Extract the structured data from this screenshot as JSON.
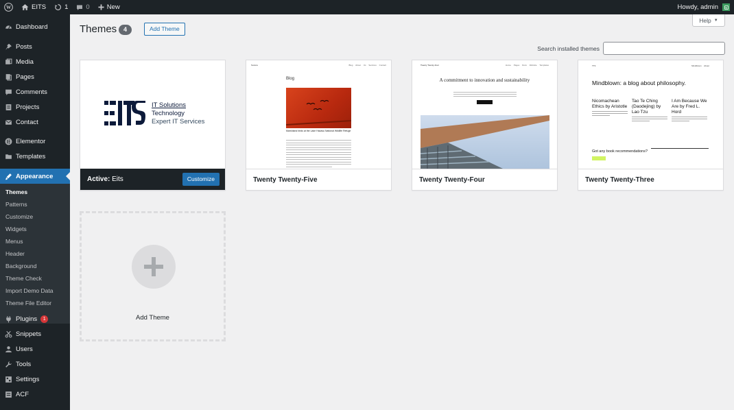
{
  "admin_bar": {
    "site_name": "EITS",
    "updates_count": "1",
    "comments_count": "0",
    "new_label": "New",
    "greeting": "Howdy, admin"
  },
  "sidebar": {
    "items": [
      {
        "label": "Dashboard",
        "icon": "dashboard-icon"
      },
      {
        "label": "Posts",
        "icon": "pin-icon"
      },
      {
        "label": "Media",
        "icon": "media-icon"
      },
      {
        "label": "Pages",
        "icon": "pages-icon"
      },
      {
        "label": "Comments",
        "icon": "comment-icon"
      },
      {
        "label": "Projects",
        "icon": "projects-icon"
      },
      {
        "label": "Contact",
        "icon": "mail-icon"
      },
      {
        "label": "Elementor",
        "icon": "elementor-icon"
      },
      {
        "label": "Templates",
        "icon": "folder-icon"
      },
      {
        "label": "Appearance",
        "icon": "brush-icon"
      },
      {
        "label": "Plugins",
        "icon": "plugin-icon",
        "badge": "1"
      },
      {
        "label": "Snippets",
        "icon": "scissors-icon"
      },
      {
        "label": "Users",
        "icon": "users-icon"
      },
      {
        "label": "Tools",
        "icon": "wrench-icon"
      },
      {
        "label": "Settings",
        "icon": "settings-icon"
      },
      {
        "label": "ACF",
        "icon": "acf-icon"
      }
    ],
    "submenu": [
      "Themes",
      "Patterns",
      "Customize",
      "Widgets",
      "Menus",
      "Header",
      "Background",
      "Theme Check",
      "Import Demo Data",
      "Theme File Editor"
    ]
  },
  "header": {
    "title": "Themes",
    "count": "4",
    "add_theme_label": "Add Theme",
    "help_label": "Help"
  },
  "search": {
    "label": "Search installed themes",
    "value": ""
  },
  "themes": [
    {
      "name": "Eits",
      "active_prefix": "Active:",
      "customize_label": "Customize",
      "preview": {
        "logo": "EITS",
        "line1": "IT Solutions",
        "line2": "Technology",
        "line3": "Expert IT Services"
      }
    },
    {
      "name": "Twenty Twenty-Five",
      "preview": {
        "site": "Sorana",
        "nav": "Blog About Us Services Contact",
        "heading": "Blog",
        "caption": "Marshland birds at the Lake Havasu National Wildlife Refuge"
      }
    },
    {
      "name": "Twenty Twenty-Four",
      "preview": {
        "site": "Twenty Twenty-Four",
        "nav": "Home Pages Docs Website Templates",
        "heading": "A commitment to innovation and sustainability"
      }
    },
    {
      "name": "Twenty Twenty-Three",
      "preview": {
        "site": "TT3",
        "nav": "Mindblown About",
        "heading": "Mindblown: a blog about philosophy.",
        "posts": [
          "Nicomachean Ethics by Aristotle",
          "Tao Te Ching (Daodejing) by Lao Tzu",
          "I Am Because We Are by Fred L. Hord"
        ],
        "cta": "Got any book recommendations?"
      }
    }
  ],
  "add_new": {
    "label": "Add Theme"
  },
  "colors": {
    "admin_dark": "#1d2327",
    "accent": "#2271b1",
    "background": "#f0f0f1",
    "eits_cyan": "#4ff1ef",
    "badge_red": "#d63638"
  }
}
